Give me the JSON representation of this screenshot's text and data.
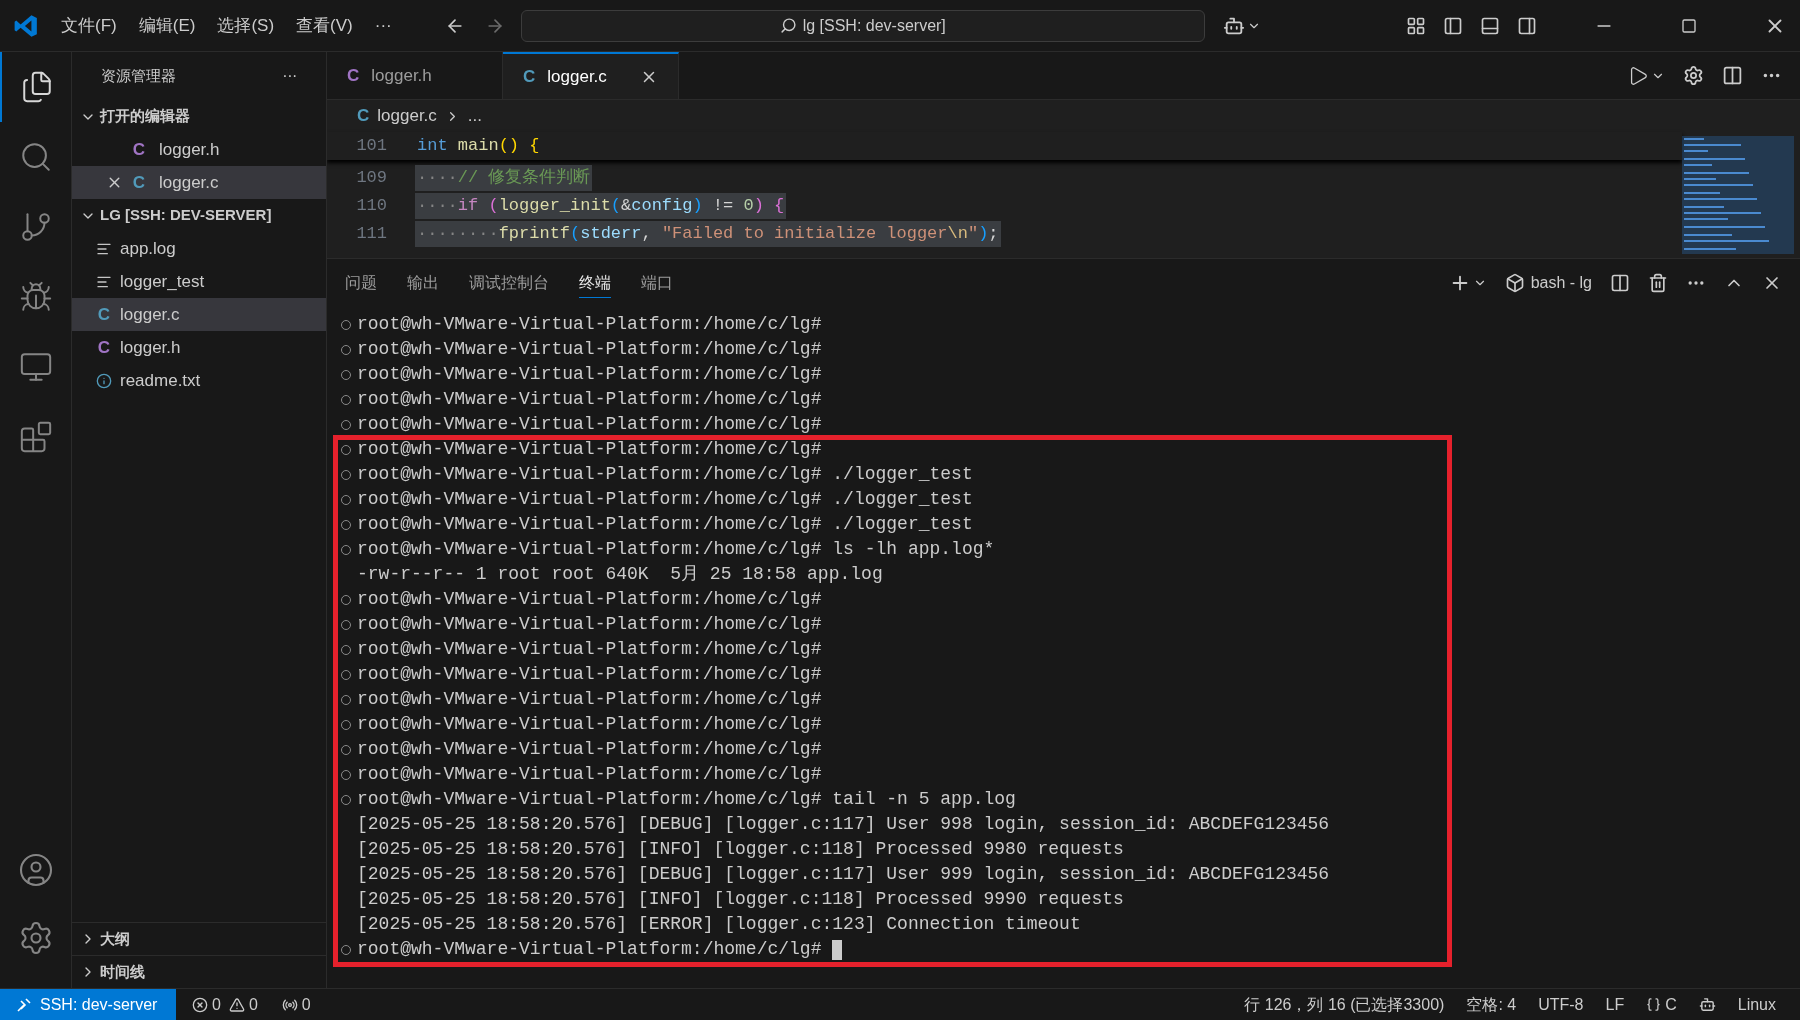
{
  "menu": [
    "文件(F)",
    "编辑(E)",
    "选择(S)",
    "查看(V)",
    "···"
  ],
  "command_center": {
    "text": "lg [SSH: dev-server]"
  },
  "sidebar": {
    "title": "资源管理器",
    "more": "···",
    "open_editors": {
      "title": "打开的编辑器",
      "expanded": true,
      "items": [
        {
          "name": "logger.h",
          "kind": "h",
          "icon": "C",
          "selected": false
        },
        {
          "name": "logger.c",
          "kind": "c",
          "icon": "C",
          "selected": true
        }
      ]
    },
    "folder": {
      "title": "LG [SSH: DEV-SERVER]",
      "expanded": true,
      "items": [
        {
          "name": "app.log",
          "kind": "text",
          "selected": false
        },
        {
          "name": "logger_test",
          "kind": "text",
          "selected": false
        },
        {
          "name": "logger.c",
          "kind": "c",
          "icon": "C",
          "selected": true
        },
        {
          "name": "logger.h",
          "kind": "h",
          "icon": "C",
          "selected": false
        },
        {
          "name": "readme.txt",
          "kind": "info",
          "selected": false
        }
      ]
    },
    "bottom_sections": [
      {
        "title": "大纲",
        "expanded": false
      },
      {
        "title": "时间线",
        "expanded": false
      }
    ]
  },
  "tabs": [
    {
      "label": "logger.h",
      "kind": "h",
      "icon": "C",
      "selected": false
    },
    {
      "label": "logger.c",
      "kind": "c",
      "icon": "C",
      "selected": true
    }
  ],
  "breadcrumb": {
    "file": "logger.c",
    "kind": "c",
    "icon": "C",
    "rest": "..."
  },
  "code": [
    {
      "number": "101",
      "selected": false,
      "tokens": [
        {
          "text": "int ",
          "color": "#569cd6"
        },
        {
          "text": "main",
          "color": "#dcdcaa"
        },
        {
          "text": "() ",
          "color": "#ffd700"
        },
        {
          "text": "{",
          "color": "#ffd700"
        }
      ]
    },
    {
      "number": "109",
      "selected": true,
      "tokens": [
        {
          "text": "····",
          "color": "#858585"
        },
        {
          "text": "// 修复条件判断",
          "color": "#6a9955"
        }
      ]
    },
    {
      "number": "110",
      "selected": true,
      "tokens": [
        {
          "text": "····",
          "color": "#858585"
        },
        {
          "text": "if ",
          "color": "#c586c0"
        },
        {
          "text": "(",
          "color": "#da70d6"
        },
        {
          "text": "logger_init",
          "color": "#dcdcaa"
        },
        {
          "text": "(",
          "color": "#179fff"
        },
        {
          "text": "&",
          "color": "#d4d4d4"
        },
        {
          "text": "config",
          "color": "#9cdcfe"
        },
        {
          "text": ")",
          "color": "#179fff"
        },
        {
          "text": " != ",
          "color": "#d4d4d4"
        },
        {
          "text": "0",
          "color": "#b5cea8"
        },
        {
          "text": ") ",
          "color": "#da70d6"
        },
        {
          "text": "{",
          "color": "#da70d6"
        }
      ]
    },
    {
      "number": "111",
      "selected": true,
      "tokens": [
        {
          "text": "········",
          "color": "#858585"
        },
        {
          "text": "fprintf",
          "color": "#dcdcaa"
        },
        {
          "text": "(",
          "color": "#179fff"
        },
        {
          "text": "stderr",
          "color": "#9cdcfe"
        },
        {
          "text": ", ",
          "color": "#d4d4d4"
        },
        {
          "text": "\"Failed to initialize logger",
          "color": "#ce9178"
        },
        {
          "text": "\\n",
          "color": "#d7ba7d"
        },
        {
          "text": "\"",
          "color": "#ce9178"
        },
        {
          "text": ")",
          "color": "#179fff"
        },
        {
          "text": ";",
          "color": "#d4d4d4"
        }
      ]
    }
  ],
  "panel": {
    "tabs": [
      {
        "label": "问题",
        "selected": false
      },
      {
        "label": "输出",
        "selected": false
      },
      {
        "label": "调试控制台",
        "selected": false
      },
      {
        "label": "终端",
        "selected": true
      },
      {
        "label": "端口",
        "selected": false
      }
    ],
    "terminal_name": "bash - lg"
  },
  "terminal": {
    "lines": [
      {
        "kind": "command",
        "text": "root@wh-VMware-Virtual-Platform:/home/c/lg#"
      },
      {
        "kind": "command",
        "text": "root@wh-VMware-Virtual-Platform:/home/c/lg#"
      },
      {
        "kind": "command",
        "text": "root@wh-VMware-Virtual-Platform:/home/c/lg#"
      },
      {
        "kind": "command",
        "text": "root@wh-VMware-Virtual-Platform:/home/c/lg#"
      },
      {
        "kind": "command",
        "text": "root@wh-VMware-Virtual-Platform:/home/c/lg#"
      }
    ],
    "boxed_lines": [
      {
        "kind": "command",
        "text": "root@wh-VMware-Virtual-Platform:/home/c/lg#"
      },
      {
        "kind": "command",
        "text": "root@wh-VMware-Virtual-Platform:/home/c/lg# ./logger_test"
      },
      {
        "kind": "command",
        "text": "root@wh-VMware-Virtual-Platform:/home/c/lg# ./logger_test"
      },
      {
        "kind": "command",
        "text": "root@wh-VMware-Virtual-Platform:/home/c/lg# ./logger_test"
      },
      {
        "kind": "command",
        "text": "root@wh-VMware-Virtual-Platform:/home/c/lg# ls -lh app.log*"
      },
      {
        "kind": "output",
        "text": "-rw-r--r-- 1 root root 640K  5月 25 18:58 app.log"
      },
      {
        "kind": "command",
        "text": "root@wh-VMware-Virtual-Platform:/home/c/lg#"
      },
      {
        "kind": "command",
        "text": "root@wh-VMware-Virtual-Platform:/home/c/lg#"
      },
      {
        "kind": "command",
        "text": "root@wh-VMware-Virtual-Platform:/home/c/lg#"
      },
      {
        "kind": "command",
        "text": "root@wh-VMware-Virtual-Platform:/home/c/lg#"
      },
      {
        "kind": "command",
        "text": "root@wh-VMware-Virtual-Platform:/home/c/lg#"
      },
      {
        "kind": "command",
        "text": "root@wh-VMware-Virtual-Platform:/home/c/lg#"
      },
      {
        "kind": "command",
        "text": "root@wh-VMware-Virtual-Platform:/home/c/lg#"
      },
      {
        "kind": "command",
        "text": "root@wh-VMware-Virtual-Platform:/home/c/lg#"
      },
      {
        "kind": "command",
        "text": "root@wh-VMware-Virtual-Platform:/home/c/lg# tail -n 5 app.log"
      },
      {
        "kind": "output",
        "text": "[2025-05-25 18:58:20.576] [DEBUG] [logger.c:117] User 998 login, session_id: ABCDEFG123456"
      },
      {
        "kind": "output",
        "text": "[2025-05-25 18:58:20.576] [INFO] [logger.c:118] Processed 9980 requests"
      },
      {
        "kind": "output",
        "text": "[2025-05-25 18:58:20.576] [DEBUG] [logger.c:117] User 999 login, session_id: ABCDEFG123456"
      },
      {
        "kind": "output",
        "text": "[2025-05-25 18:58:20.576] [INFO] [logger.c:118] Processed 9990 requests"
      },
      {
        "kind": "output",
        "text": "[2025-05-25 18:58:20.576] [ERROR] [logger.c:123] Connection timeout"
      },
      {
        "kind": "prompt",
        "text": "root@wh-VMware-Virtual-Platform:/home/c/lg#"
      }
    ]
  },
  "status_bar": {
    "remote": "SSH: dev-server",
    "errors": "0",
    "warnings": "0",
    "ports": "0",
    "right": [
      {
        "kind": "text",
        "text": "行 126，列 16 (已选择3300)"
      },
      {
        "kind": "text",
        "text": "空格: 4"
      },
      {
        "kind": "text",
        "text": "UTF-8"
      },
      {
        "kind": "text",
        "text": "LF"
      },
      {
        "kind": "language",
        "text": "C"
      },
      {
        "kind": "copilot"
      },
      {
        "kind": "text",
        "text": "Linux"
      }
    ]
  }
}
